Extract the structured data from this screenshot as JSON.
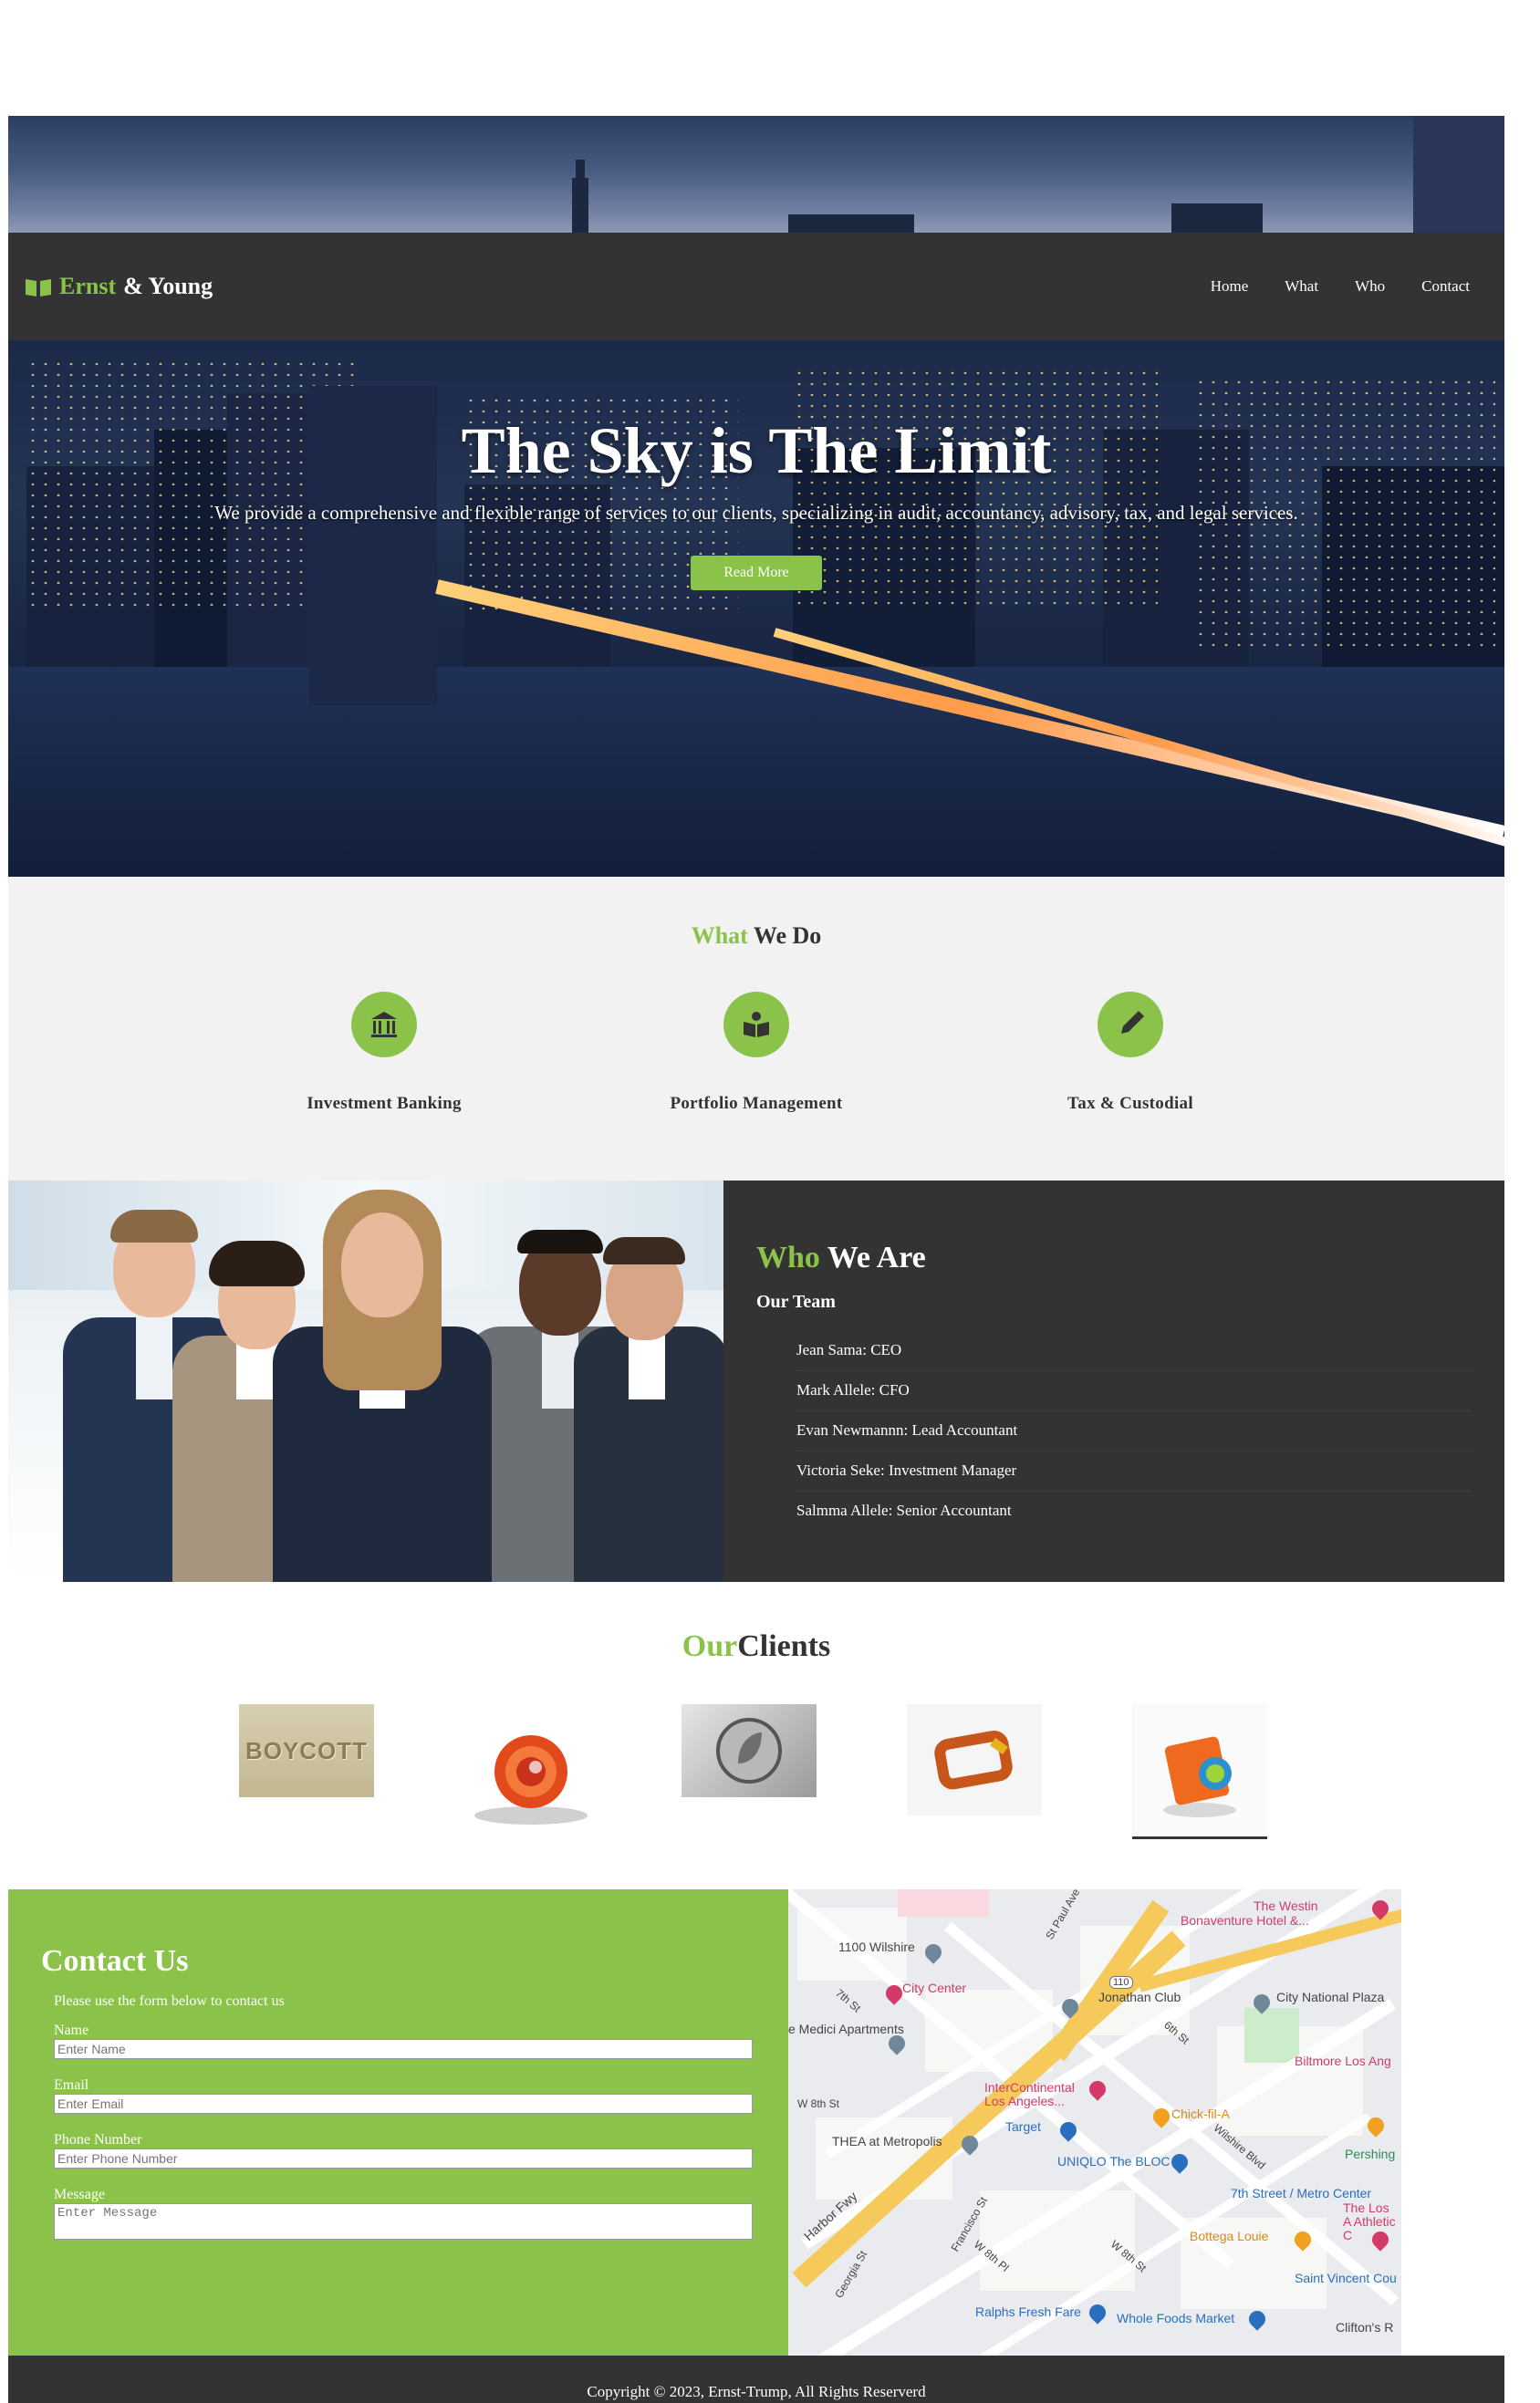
{
  "colors": {
    "accent": "#8bc34a",
    "dark": "#333333",
    "light_section": "#f2f2f2"
  },
  "nav": {
    "brand_icon": "book-icon",
    "brand_first": "Ernst",
    "brand_rest": "& Young",
    "links": [
      "Home",
      "What",
      "Who",
      "Contact"
    ]
  },
  "hero": {
    "title": "The Sky is The Limit",
    "subtitle": "We provide a comprehensive and flexible range of services to our clients, specializing in audit, accountancy, advisory, tax, and legal services.",
    "button": "Read More"
  },
  "what": {
    "title_green": "What",
    "title_rest": "We Do",
    "services": [
      {
        "icon": "bank-icon",
        "label": "Investment Banking"
      },
      {
        "icon": "book-open-icon",
        "label": "Portfolio Management"
      },
      {
        "icon": "pencil-icon",
        "label": "Tax & Custodial"
      }
    ]
  },
  "who": {
    "title_green": "Who",
    "title_rest": "We Are",
    "team_heading": "Our Team",
    "team": [
      "Jean Sama: CEO",
      "Mark Allele: CFO",
      "Evan Newmannn: Lead Accountant",
      "Victoria Seke: Investment Manager",
      "Salmma Allele: Senior Accountant"
    ]
  },
  "clients": {
    "title_green": "Our",
    "title_rest": "Clients",
    "logo_text": "BOYCOTT"
  },
  "contact": {
    "title": "Contact Us",
    "note": "Please use the form below to contact us",
    "fields": {
      "name_label": "Name",
      "name_placeholder": "Enter Name",
      "email_label": "Email",
      "email_placeholder": "Enter Email",
      "phone_label": "Phone Number",
      "phone_placeholder": "Enter Phone Number",
      "message_label": "Message",
      "message_placeholder": "Enter Message"
    }
  },
  "map": {
    "labels": {
      "westin": "The Westin",
      "bonaventure": "Bonaventure Hotel &...",
      "wilshire_1100": "1100 Wilshire",
      "city_center": "City Center",
      "jonathan": "Jonathan Club",
      "city_national": "City National Plaza",
      "medici": "e Medici Apartments",
      "biltmore": "Biltmore Los Ang",
      "intercontinental": "InterContinental Los Angeles...",
      "chick": "Chick-fil-A",
      "w8th": "W 8th St",
      "target": "Target",
      "thea": "THEA at Metropolis",
      "uniqlo": "UNIQLO The BLOC",
      "pershing": "Pershing",
      "metro": "7th Street / Metro Center",
      "los_athletic": "The Los A Athletic C",
      "harbor": "Harbor Fwy",
      "bottega": "Bottega Louie",
      "saint_vincent": "Saint Vincent Cou",
      "ralphs": "Ralphs Fresh Fare",
      "whole_foods": "Whole Foods Market",
      "cliftons": "Clifton's R",
      "st_7th": "7th St",
      "st_6th": "6th St",
      "wilshire_blvd": "Wilshire Blvd",
      "francisco": "Francisco St",
      "georgia": "Georgia St",
      "w8th_pl": "W 8th Pl",
      "w8th_st2": "W 8th St",
      "st_paul": "St Paul Ave",
      "hwy110": "110"
    }
  },
  "footer": {
    "copyright": "Copyright © 2023, Ernst-Trump, All Rights Reserverd"
  }
}
